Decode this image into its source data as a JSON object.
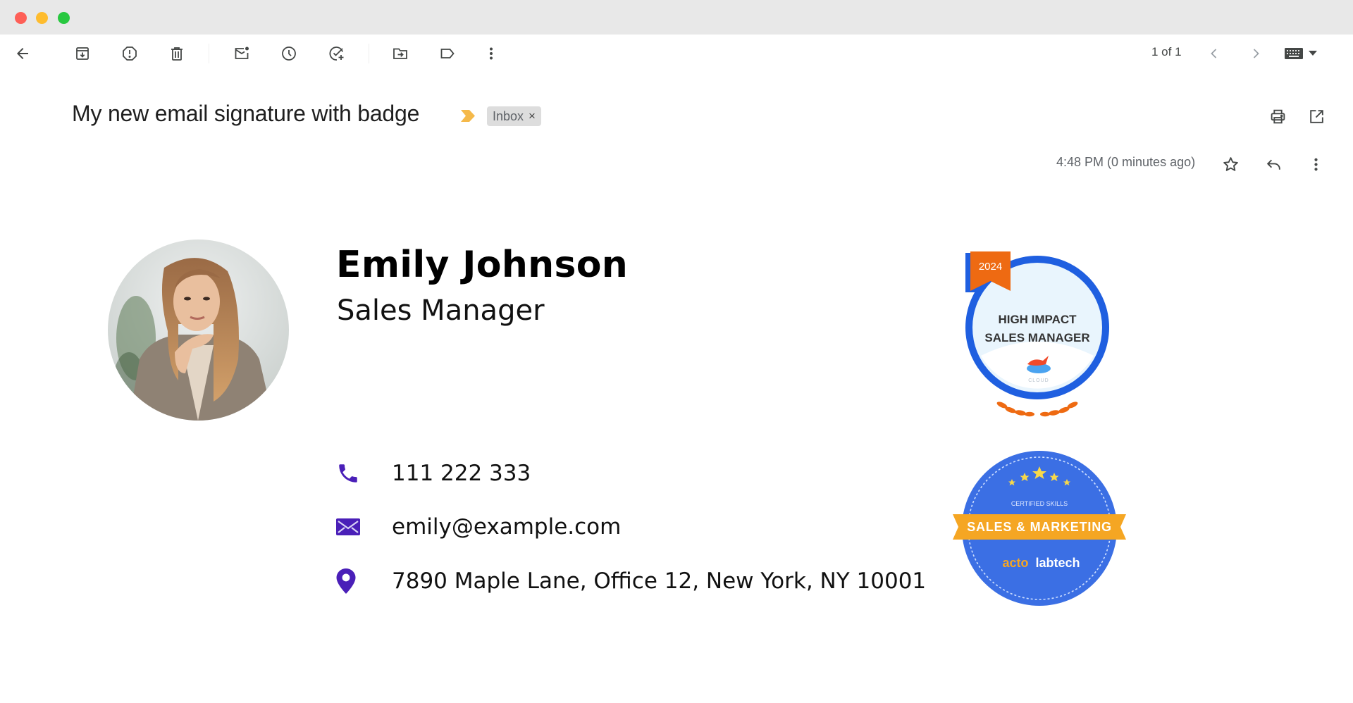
{
  "window": {
    "controls": [
      "close",
      "minimize",
      "maximize"
    ]
  },
  "toolbar": {
    "buttons": [
      {
        "name": "back",
        "icon": "arrow-left-icon",
        "tooltip": "Back to Inbox"
      },
      {
        "name": "archive",
        "icon": "archive-icon",
        "tooltip": "Archive"
      },
      {
        "name": "report-spam",
        "icon": "report-spam-icon",
        "tooltip": "Report spam"
      },
      {
        "name": "delete",
        "icon": "trash-icon",
        "tooltip": "Delete"
      },
      {
        "name": "mark-unread",
        "icon": "mark-unread-icon",
        "tooltip": "Mark as unread"
      },
      {
        "name": "snooze",
        "icon": "clock-icon",
        "tooltip": "Snooze"
      },
      {
        "name": "add-to-tasks",
        "icon": "add-task-icon",
        "tooltip": "Add to Tasks"
      },
      {
        "name": "move-to",
        "icon": "move-to-folder-icon",
        "tooltip": "Move to"
      },
      {
        "name": "labels",
        "icon": "label-icon",
        "tooltip": "Labels"
      },
      {
        "name": "more",
        "icon": "more-vert-icon",
        "tooltip": "More"
      }
    ],
    "pager": "1 of 1",
    "input_tools": "keyboard-icon"
  },
  "message": {
    "subject": "My new email signature with badge",
    "label_chip": "Inbox",
    "label_chip_close": "×",
    "timestamp": "4:48 PM (0 minutes ago)",
    "importance_color": "#f5b94a"
  },
  "signature": {
    "name": "Emily Johnson",
    "title": "Sales Manager",
    "contacts": [
      {
        "type": "phone",
        "icon": "phone-icon",
        "value": "111 222 333"
      },
      {
        "type": "email",
        "icon": "envelope-icon",
        "value": "emily@example.com"
      },
      {
        "type": "address",
        "icon": "location-pin-icon",
        "value": "7890 Maple Lane, Office 12, New York, NY 10001"
      }
    ],
    "icon_color": "#4a1fb8",
    "badges": [
      {
        "year": "2024",
        "line1": "HIGH IMPACT",
        "line2": "SALES MANAGER",
        "logo_text": "CLOUD",
        "ring_color": "#1f5fe0",
        "ribbon_color": "#ee6a12"
      },
      {
        "top": "CERTIFIED SKILLS",
        "ribbon": "SALES & MARKETING",
        "brand_a": "acto",
        "brand_b": "labtech",
        "bg_color": "#3b6fe4",
        "ribbon_color": "#f5a623",
        "stars": 5
      }
    ]
  }
}
